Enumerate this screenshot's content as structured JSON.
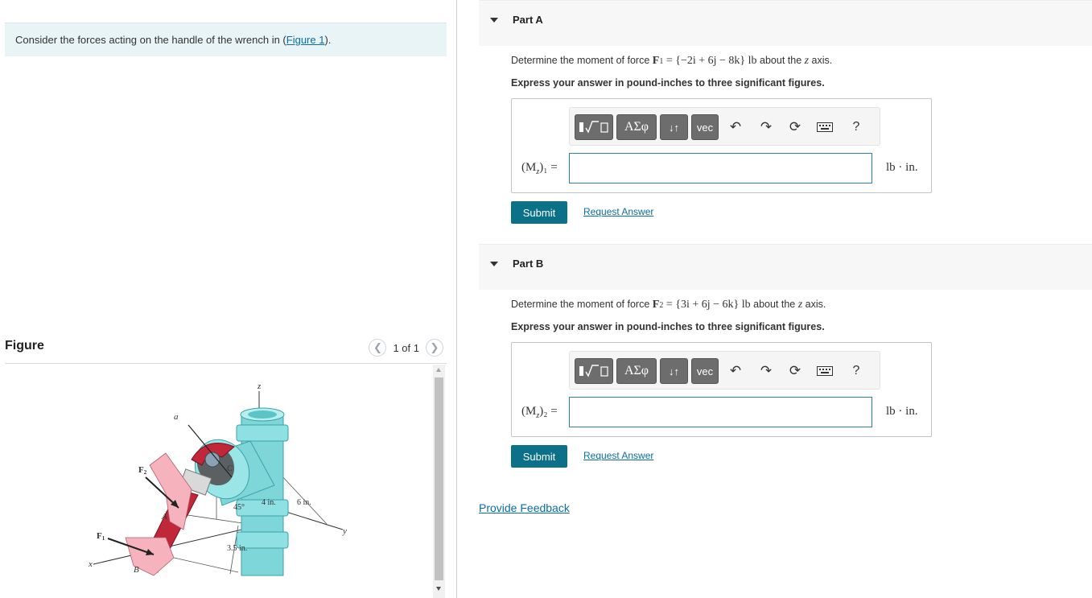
{
  "problem": {
    "intro_text": "Consider the forces acting on the handle of the wrench in (",
    "intro_link": "Figure 1",
    "intro_end": ")."
  },
  "figure_panel": {
    "title": "Figure",
    "pager_text": "1 of 1",
    "prev_icon": "chevron-left-icon",
    "next_icon": "chevron-right-icon",
    "labels": {
      "z": "z",
      "a": "a",
      "F2": "F",
      "F2_sub": "2",
      "F1": "F",
      "F1_sub": "1",
      "x": "x",
      "y": "y",
      "A": "A",
      "B": "B",
      "C": "C",
      "angle": "45°",
      "dim_4in": "4 in.",
      "dim_6in": "6 in.",
      "dim_35in": "3.5 in."
    }
  },
  "parts": [
    {
      "title": "Part A",
      "q_prefix": "Determine the moment of force ",
      "q_force": "F",
      "q_sub": "1",
      "q_vector": " = {−2i + 6j − 8k} lb",
      "q_suffix": " about the ",
      "q_axis": "z",
      "q_end": " axis.",
      "instruction": "Express your answer in pound-inches to three significant figures.",
      "answer_label": "(M",
      "answer_label_sub": "z",
      "answer_label_end": ")₁ =",
      "answer_value": "",
      "unit": "lb · in.",
      "submit_label": "Submit",
      "request_label": "Request Answer"
    },
    {
      "title": "Part B",
      "q_prefix": "Determine the moment of force ",
      "q_force": "F",
      "q_sub": "2",
      "q_vector": " = {3i + 6j − 6k} lb",
      "q_suffix": " about the ",
      "q_axis": "z",
      "q_end": " axis.",
      "instruction": "Express your answer in pound-inches to three significant figures.",
      "answer_label": "(M",
      "answer_label_sub": "z",
      "answer_label_end": ")₂ =",
      "answer_value": "",
      "unit": "lb · in.",
      "submit_label": "Submit",
      "request_label": "Request Answer"
    }
  ],
  "toolbar": {
    "templates_icon": "fraction-radical-icon",
    "greek_label": "ΑΣφ",
    "arrows_label": "↓↑",
    "vec_label": "vec",
    "undo_icon": "undo-icon",
    "redo_icon": "redo-icon",
    "reset_icon": "reset-icon",
    "keyboard_icon": "keyboard-icon",
    "help_label": "?"
  },
  "feedback_label": "Provide Feedback",
  "colors": {
    "submit": "#0b7189",
    "link": "#0a6ea8",
    "intro_bg": "#e8f4f6",
    "pipe": "#7fd6d8",
    "wrench": "#c0283a"
  }
}
